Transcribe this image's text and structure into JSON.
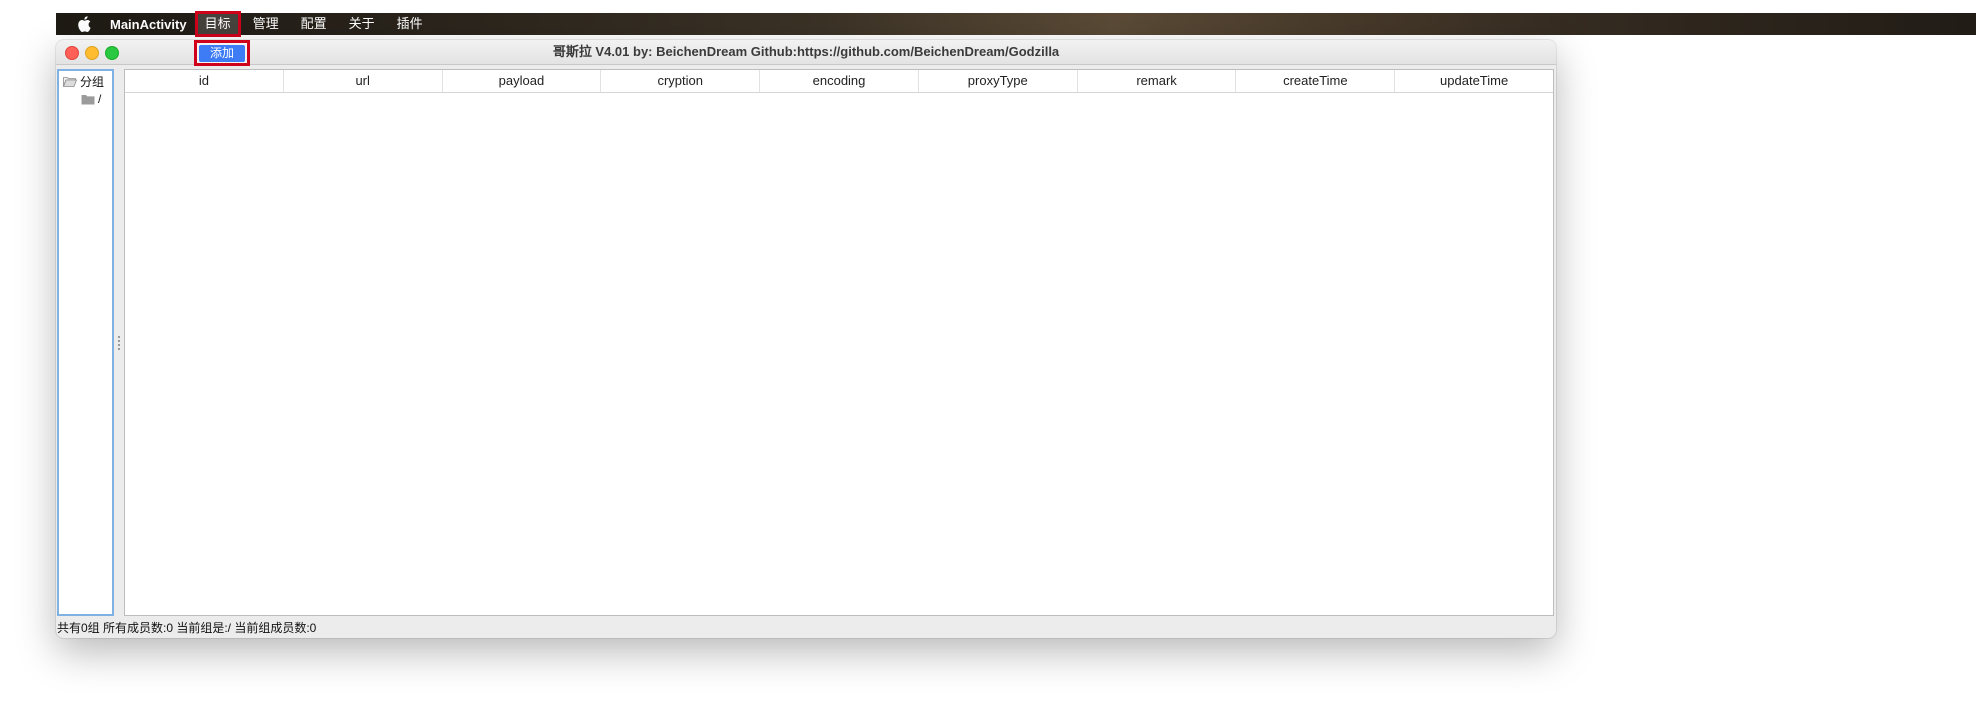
{
  "menubar": {
    "app_name": "MainActivity",
    "items": [
      {
        "label": "目标"
      },
      {
        "label": "管理"
      },
      {
        "label": "配置"
      },
      {
        "label": "关于"
      },
      {
        "label": "插件"
      }
    ]
  },
  "dropdown": {
    "items": [
      {
        "label": "添加"
      }
    ]
  },
  "window": {
    "title": "哥斯拉   V4.01 by: BeichenDream Github:https://github.com/BeichenDream/Godzilla"
  },
  "tree": {
    "root_label": "分组",
    "child_label": "/"
  },
  "table": {
    "columns": [
      "id",
      "url",
      "payload",
      "cryption",
      "encoding",
      "proxyType",
      "remark",
      "createTime",
      "updateTime"
    ],
    "rows": []
  },
  "statusbar": {
    "text": "共有0组 所有成员数:0 当前组是:/ 当前组成员数:0"
  },
  "colors": {
    "highlight_outline": "#d0021b",
    "menu_selection": "#3d7cf5",
    "tree_border": "#7fb1e2"
  }
}
